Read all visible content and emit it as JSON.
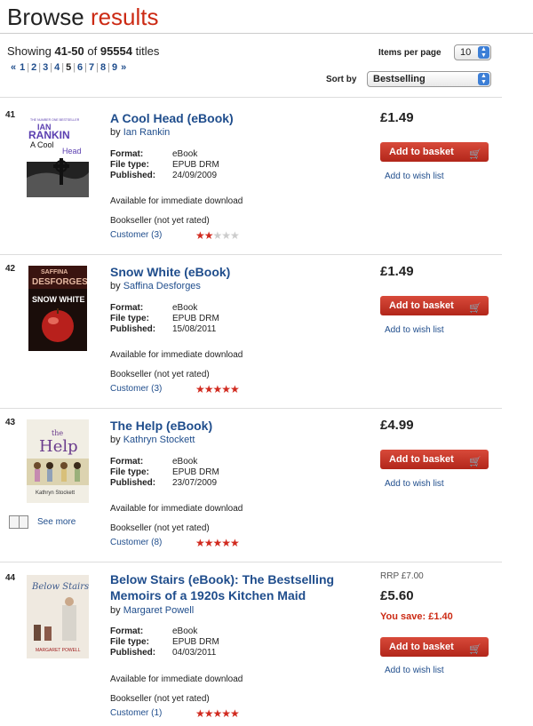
{
  "header": {
    "title_plain": "Browse",
    "title_accent": "results"
  },
  "summary": {
    "prefix": "Showing",
    "range": "41-50",
    "mid": "of",
    "total": "95554",
    "suffix": "titles"
  },
  "pager": {
    "prev": "«",
    "next": "»",
    "pages": [
      "1",
      "2",
      "3",
      "4",
      "5",
      "6",
      "7",
      "8",
      "9"
    ],
    "current": "5"
  },
  "controls": {
    "items_per_page_label": "Items per page",
    "items_per_page_value": "10",
    "sort_label": "Sort by",
    "sort_value": "Bestselling"
  },
  "labels": {
    "format": "Format:",
    "file_type": "File type:",
    "published": "Published:",
    "availability": "Available for immediate download",
    "bookseller": "Bookseller (not yet rated)",
    "customer_prefix": "Customer",
    "add_to_basket": "Add to basket",
    "wish_list": "Add to wish list",
    "see_more": "See more"
  },
  "results": [
    {
      "num": "41",
      "title": "A Cool Head (eBook)",
      "author_prefix": "by",
      "author": "Ian Rankin",
      "format": "eBook",
      "file_type": "EPUB DRM",
      "published": "24/09/2009",
      "customer_count": "(3)",
      "stars": 2,
      "price": "£1.49",
      "cover_text": {
        "top": "THE NUMBER ONE BESTSELLER",
        "name1": "IAN",
        "name2": "RANKIN",
        "title1": "A Cool",
        "title2": "Head"
      }
    },
    {
      "num": "42",
      "title": "Snow White (eBook)",
      "author_prefix": "by",
      "author": "Saffina Desforges",
      "format": "eBook",
      "file_type": "EPUB DRM",
      "published": "15/08/2011",
      "customer_count": "(3)",
      "stars": 5,
      "price": "£1.49",
      "cover_text": {
        "name1": "SAFFINA",
        "name2": "DESFORGES",
        "title1": "SNOW WHITE"
      }
    },
    {
      "num": "43",
      "title": "The Help (eBook)",
      "author_prefix": "by",
      "author": "Kathryn Stockett",
      "format": "eBook",
      "file_type": "EPUB DRM",
      "published": "23/07/2009",
      "customer_count": "(8)",
      "stars": 5,
      "price": "£4.99",
      "cover_text": {
        "title1": "the",
        "title2": "Help",
        "name1": "Kathryn Stockett"
      }
    },
    {
      "num": "44",
      "title": "Below Stairs (eBook): The Bestselling Memoirs of a 1920s Kitchen Maid",
      "author_prefix": "by",
      "author": "Margaret Powell",
      "format": "eBook",
      "file_type": "EPUB DRM",
      "published": "04/03/2011",
      "customer_count": "(1)",
      "stars": 5,
      "rrp": "RRP £7.00",
      "price": "£5.60",
      "save": "You save: £1.40",
      "cover_text": {
        "title1": "Below Stairs",
        "name1": "MARGARET POWELL"
      }
    }
  ]
}
